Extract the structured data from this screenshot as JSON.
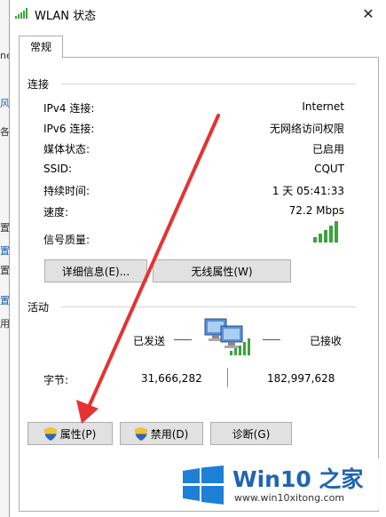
{
  "background_window": {
    "chars": [
      {
        "text": "ne",
        "blue": false
      },
      {
        "text": "风",
        "blue": true
      },
      {
        "text": "各",
        "blue": false
      },
      {
        "text": "置",
        "blue": false
      },
      {
        "text": "置",
        "blue": true
      },
      {
        "text": "置",
        "blue": false
      },
      {
        "text": "置",
        "blue": true
      },
      {
        "text": "用",
        "blue": false
      }
    ]
  },
  "window": {
    "title": "WLAN 状态",
    "close_glyph": "✕"
  },
  "tab": {
    "label": "常规"
  },
  "connection": {
    "heading": "连接",
    "rows": [
      {
        "label": "IPv4 连接:",
        "value": "Internet"
      },
      {
        "label": "IPv6 连接:",
        "value": "无网络访问权限"
      },
      {
        "label": "媒体状态:",
        "value": "已启用"
      },
      {
        "label": "SSID:",
        "value": "CQUT"
      },
      {
        "label": "持续时间:",
        "value": "1 天 05:41:33"
      },
      {
        "label": "速度:",
        "value": "72.2 Mbps"
      }
    ],
    "signal_label": "信号质量:",
    "signal_icon": "signal-bars-icon",
    "details_button": "详细信息(E)...",
    "wireless_button": "无线属性(W)"
  },
  "activity": {
    "heading": "活动",
    "sent_label": "已发送",
    "received_label": "已接收",
    "bytes_label": "字节:",
    "bytes_sent": "31,666,282",
    "bytes_received": "182,997,628",
    "network_icon": "network-computers-icon"
  },
  "bottom_buttons": {
    "properties": "属性(P)",
    "disable": "禁用(D)",
    "diagnose": "诊断(G)"
  },
  "watermark": {
    "name": "Win10 之家",
    "url": "www.win10xitong.com"
  },
  "colors": {
    "signal_green": "#3aa33a",
    "arrow_red": "#e53333",
    "watermark_blue": "#1e64b4",
    "button_gray": "#e1e1e1"
  }
}
